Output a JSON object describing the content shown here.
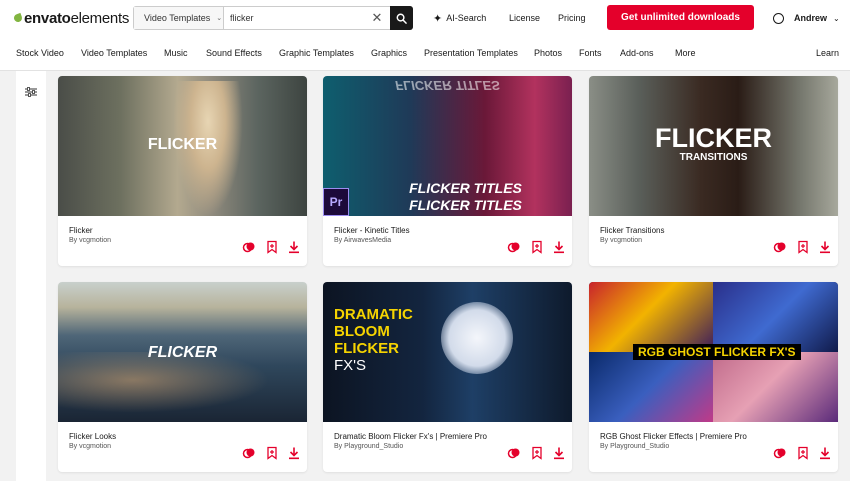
{
  "brand": {
    "name_bold": "envato",
    "name_light": "elements"
  },
  "search": {
    "category": "Video Templates",
    "query": "flicker",
    "placeholder": ""
  },
  "header": {
    "ai_search": "AI-Search",
    "license": "License",
    "pricing": "Pricing",
    "cta": "Get unlimited downloads",
    "user": "Andrew"
  },
  "nav": {
    "items": [
      "Stock Video",
      "Video Templates",
      "Music",
      "Sound Effects",
      "Graphic Templates",
      "Graphics",
      "Presentation Templates",
      "Photos",
      "Fonts",
      "Add-ons",
      "More"
    ],
    "learn": "Learn"
  },
  "colors": {
    "accent": "#e4002b",
    "brand_green": "#82b541"
  },
  "cards": [
    {
      "title": "Flicker",
      "author": "By vcgmotion",
      "overlay": "FLICKER"
    },
    {
      "title": "Flicker - Kinetic Titles",
      "author": "By AirwavesMedia",
      "overlay": "FLICKER TITLES",
      "badge": "Pr"
    },
    {
      "title": "Flicker Transitions",
      "author": "By vcgmotion",
      "overlay": "FLICKER",
      "overlay_sub": "TRANSITIONS"
    },
    {
      "title": "Flicker Looks",
      "author": "By vcgmotion",
      "overlay": "FLICKER"
    },
    {
      "title": "Dramatic Bloom Flicker Fx's | Premiere Pro",
      "author": "By Playground_Studio",
      "overlay_lines": [
        "DRAMATIC",
        "BLOOM",
        "FLICKER",
        "FX'S"
      ]
    },
    {
      "title": "RGB Ghost Flicker Effects | Premiere Pro",
      "author": "By Playground_Studio",
      "overlay": "RGB GHOST FLICKER FX'S"
    }
  ]
}
